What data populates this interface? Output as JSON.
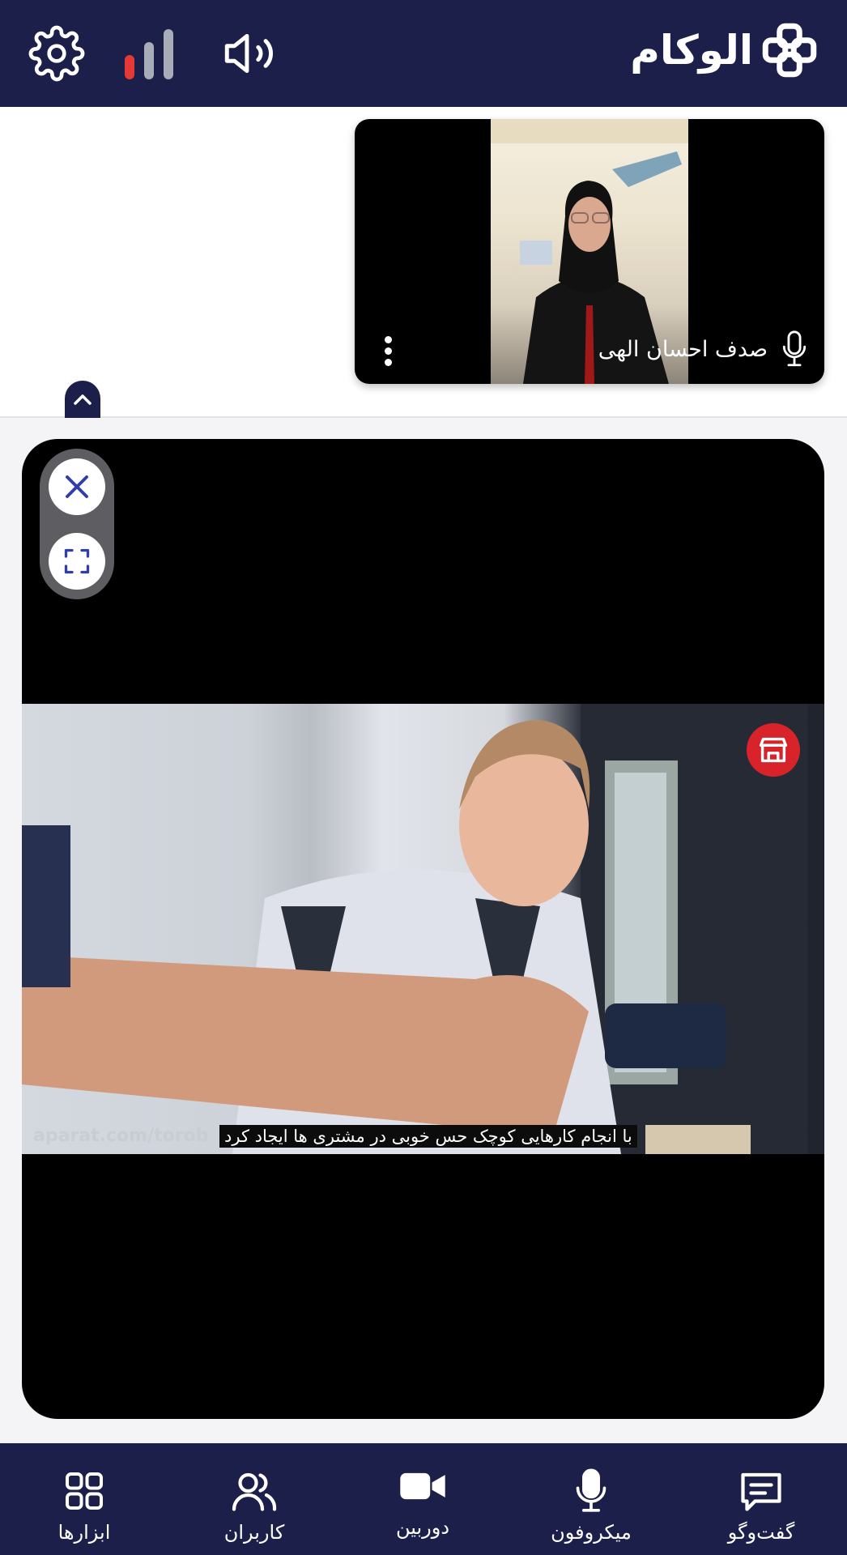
{
  "app": {
    "logo_text": "الوکام",
    "brand_color": "#1c1f4a",
    "accent_color": "#e53935"
  },
  "header": {
    "icons": [
      "gear-icon",
      "signal-strength-icon",
      "speaker-icon"
    ],
    "signal": {
      "level": 1,
      "max": 3
    }
  },
  "participant": {
    "name": "صدف احسان الهی",
    "mic_icon": "microphone-icon",
    "more_icon": "more-vertical-icon"
  },
  "stage": {
    "controls": [
      "close-icon",
      "fullscreen-icon"
    ],
    "watermark": "aparat.com/torob",
    "subtitle": "با انجام کارهایی کوچک حس خوبی در مشتری ها ایجاد کرد"
  },
  "bottom_nav": {
    "items": [
      {
        "label": "ابزارها",
        "icon": "grid-icon"
      },
      {
        "label": "کاربران",
        "icon": "users-icon"
      },
      {
        "label": "دوربین",
        "icon": "camera-icon"
      },
      {
        "label": "میکروفون",
        "icon": "microphone-icon"
      },
      {
        "label": "گفت‌وگو",
        "icon": "chat-icon"
      }
    ]
  }
}
